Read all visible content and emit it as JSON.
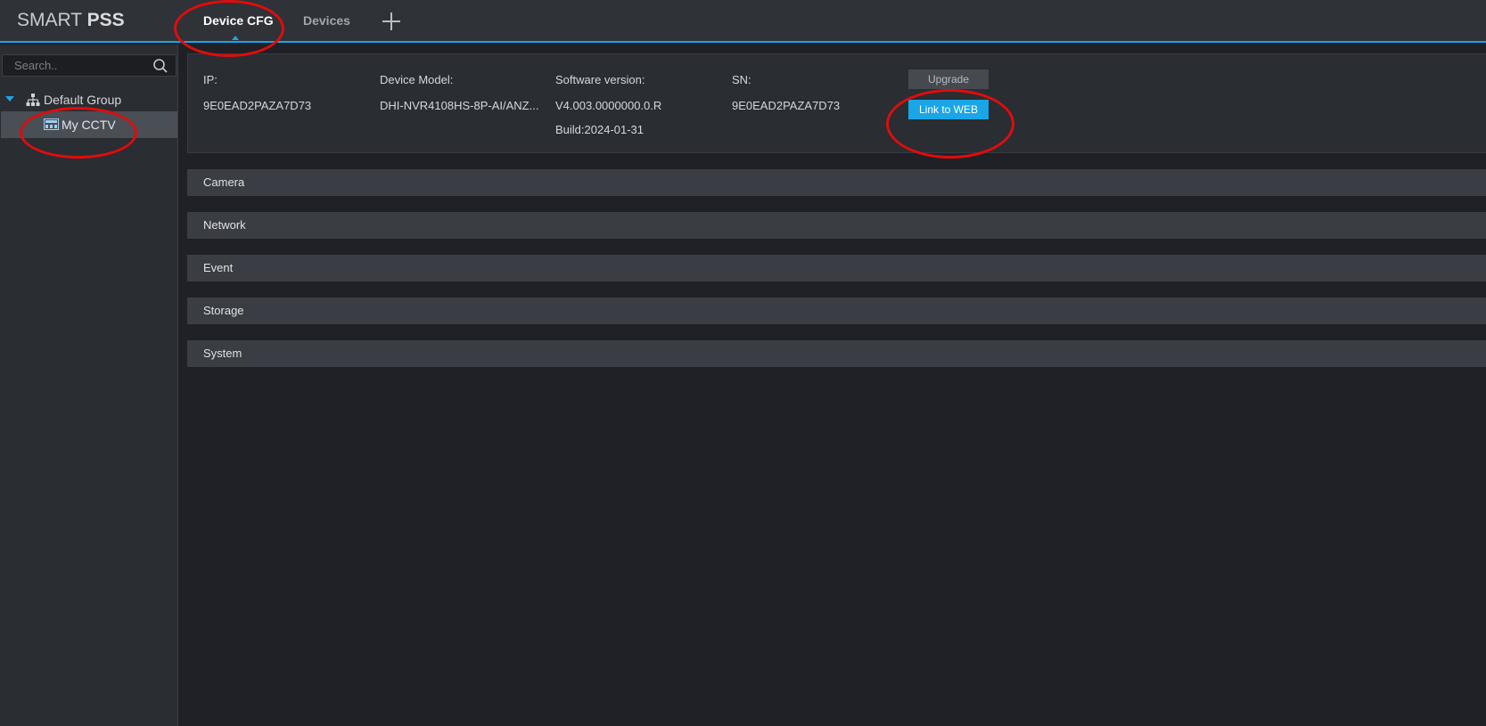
{
  "app": {
    "logo_thin": "SMART ",
    "logo_bold": "PSS"
  },
  "tabs": [
    {
      "label": "Device CFG",
      "active": true
    },
    {
      "label": "Devices",
      "active": false
    }
  ],
  "sidebar": {
    "search_placeholder": "Search..",
    "tree": {
      "group_label": "Default Group",
      "device_label": "My CCTV",
      "group_icon": "device-tree-icon",
      "device_icon": "nvr-device-icon"
    }
  },
  "device_info": {
    "ip_label": "IP:",
    "ip_value": "9E0EAD2PAZA7D73",
    "model_label": "Device Model:",
    "model_value": "DHI-NVR4108HS-8P-AI/ANZ...",
    "software_label": "Software version:",
    "software_value": "V4.003.0000000.0.R",
    "build_value": "Build:2024-01-31",
    "sn_label": "SN:",
    "sn_value": "9E0EAD2PAZA7D73",
    "upgrade_label": "Upgrade",
    "link_web_label": "Link to WEB"
  },
  "sections": [
    {
      "label": "Camera"
    },
    {
      "label": "Network"
    },
    {
      "label": "Event"
    },
    {
      "label": "Storage"
    },
    {
      "label": "System"
    }
  ],
  "colors": {
    "accent": "#1aa5e6",
    "annotation": "#e00c0c",
    "background": "#1f2126"
  }
}
